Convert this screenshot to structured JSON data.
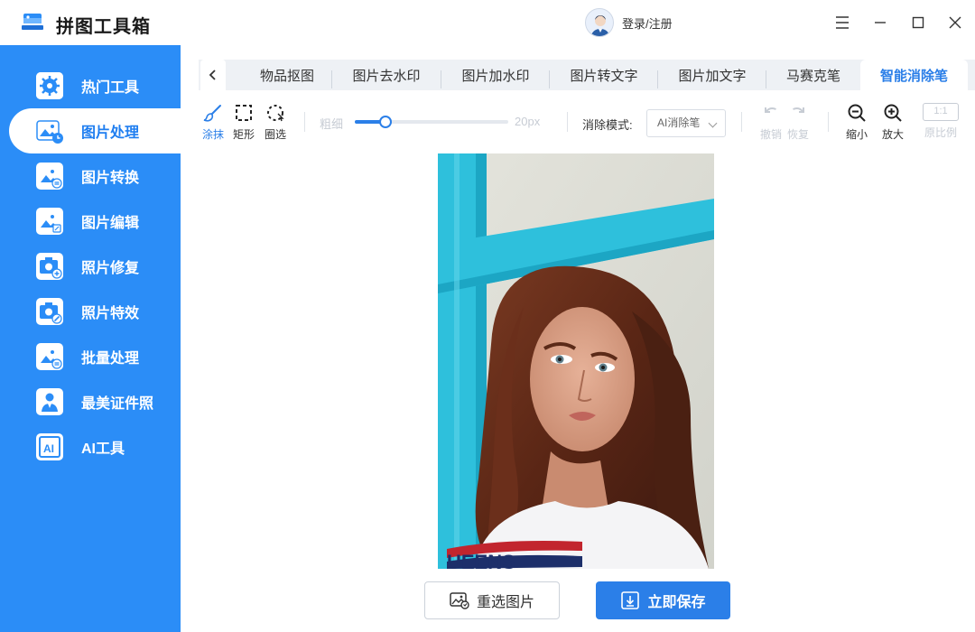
{
  "app": {
    "title": "拼图工具箱",
    "login_label": "登录/注册"
  },
  "sidebar": {
    "items": [
      {
        "label": "热门工具",
        "icon": "gear-icon"
      },
      {
        "label": "图片处理",
        "icon": "image-clock-icon",
        "active": true
      },
      {
        "label": "图片转换",
        "icon": "image-convert-icon"
      },
      {
        "label": "图片编辑",
        "icon": "image-edit-icon"
      },
      {
        "label": "照片修复",
        "icon": "camera-plus-icon"
      },
      {
        "label": "照片特效",
        "icon": "camera-magic-icon"
      },
      {
        "label": "批量处理",
        "icon": "image-batch-icon"
      },
      {
        "label": "最美证件照",
        "icon": "id-photo-icon"
      },
      {
        "label": "AI工具",
        "icon": "ai-icon"
      }
    ]
  },
  "tabs": [
    {
      "label": "物品抠图"
    },
    {
      "label": "图片去水印"
    },
    {
      "label": "图片加水印"
    },
    {
      "label": "图片转文字"
    },
    {
      "label": "图片加文字"
    },
    {
      "label": "马赛克笔"
    },
    {
      "label": "智能消除笔",
      "active": true
    }
  ],
  "toolbar": {
    "smear": "涂抹",
    "rect": "矩形",
    "lasso": "圈选",
    "thickness_label": "粗细",
    "thickness_value": "20px",
    "thickness_fraction": 0.2,
    "mode_label": "消除模式:",
    "mode_value": "AI消除笔",
    "undo": "撤销",
    "redo": "恢复",
    "zoom_out": "缩小",
    "zoom_in": "放大",
    "original_ratio_box": "1:1",
    "original_ratio": "原比例"
  },
  "bottom": {
    "reselect": "重选图片",
    "save": "立即保存"
  },
  "colors": {
    "accent": "#2b7fe8",
    "sidebar": "#2b8df7",
    "disabled": "#c7ccd4"
  }
}
